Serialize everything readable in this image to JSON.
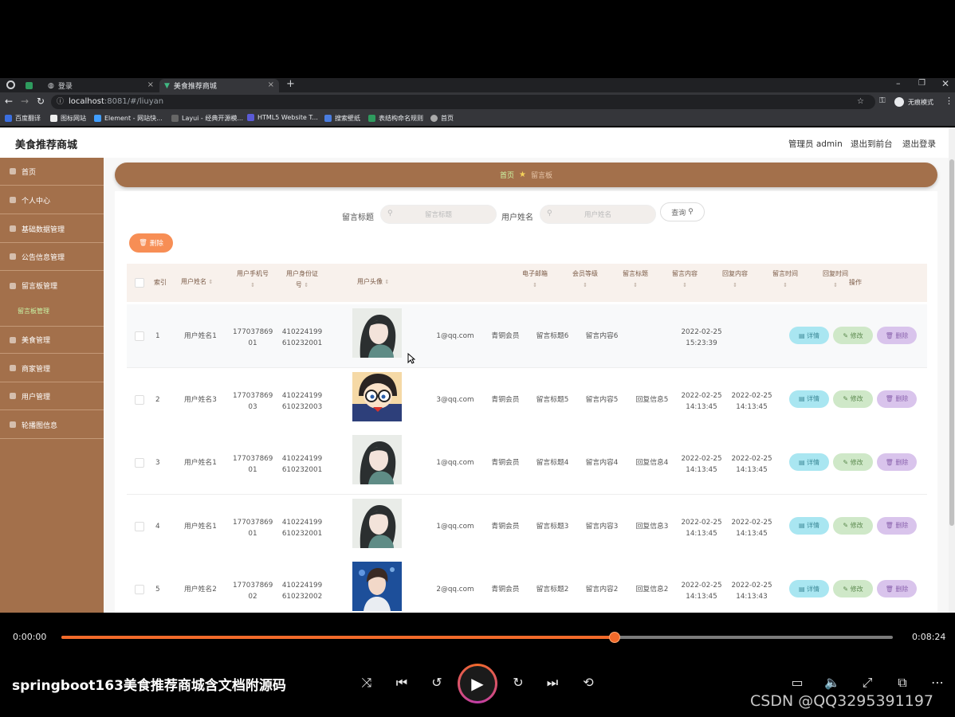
{
  "browser": {
    "tabs": [
      {
        "label": ""
      },
      {
        "label": "登录"
      },
      {
        "label": "美食推荐商城"
      }
    ],
    "url_host": "localhost",
    "url_rest": ":8081/#/liuyan",
    "profile_label": "无痕模式",
    "bookmarks": [
      "百度翻译",
      "图标网站",
      "Element - 网站快...",
      "Layui - 经典开源模...",
      "HTML5 Website T...",
      "搜索壁纸",
      "表结构命名规则",
      "首页"
    ]
  },
  "app": {
    "brand": "美食推荐商城",
    "header_links": {
      "admin": "管理员 admin",
      "front": "退出到前台",
      "logout": "退出登录"
    },
    "sidebar": {
      "items": [
        {
          "label": "首页"
        },
        {
          "label": "个人中心"
        },
        {
          "label": "基础数据管理"
        },
        {
          "label": "公告信息管理"
        },
        {
          "label": "留言板管理"
        },
        {
          "label": "美食管理"
        },
        {
          "label": "商家管理"
        },
        {
          "label": "用户管理"
        },
        {
          "label": "轮播图信息"
        }
      ],
      "active_sub": "留言板管理"
    },
    "breadcrumb": {
      "home": "首页",
      "current": "留言板"
    },
    "filters": {
      "title_label": "留言标题",
      "title_placeholder": "留言标题",
      "user_label": "用户姓名",
      "user_placeholder": "用户姓名",
      "search_button": "查询"
    },
    "delete_button": "删除",
    "table": {
      "headers": {
        "index": "索引",
        "user_name": "用户姓名",
        "phone": "用户手机号",
        "id_card_1": "用户身份证",
        "id_card_2": "号",
        "avatar": "用户头像",
        "email": "电子邮箱",
        "level": "会员等级",
        "msg_title": "留言标题",
        "msg_content": "留言内容",
        "reply_content": "回复内容",
        "msg_time": "留言时间",
        "reply_time": "回复时间",
        "actions": "操作"
      },
      "rows": [
        {
          "index": "1",
          "name": "用户姓名1",
          "phone_1": "177037869",
          "phone_2": "01",
          "id_1": "410224199",
          "id_2": "610232001",
          "email": "1@qq.com",
          "level": "青铜会员",
          "title": "留言标题6",
          "content": "留言内容6",
          "reply": "",
          "mtime_1": "2022-02-25",
          "mtime_2": "15:23:39",
          "rtime_1": "",
          "rtime_2": "",
          "avatar": "girl"
        },
        {
          "index": "2",
          "name": "用户姓名3",
          "phone_1": "177037869",
          "phone_2": "03",
          "id_1": "410224199",
          "id_2": "610232003",
          "email": "3@qq.com",
          "level": "青铜会员",
          "title": "留言标题5",
          "content": "留言内容5",
          "reply": "回复信息5",
          "mtime_1": "2022-02-25",
          "mtime_2": "14:13:45",
          "rtime_1": "2022-02-25",
          "rtime_2": "14:13:45",
          "avatar": "boy"
        },
        {
          "index": "3",
          "name": "用户姓名1",
          "phone_1": "177037869",
          "phone_2": "01",
          "id_1": "410224199",
          "id_2": "610232001",
          "email": "1@qq.com",
          "level": "青铜会员",
          "title": "留言标题4",
          "content": "留言内容4",
          "reply": "回复信息4",
          "mtime_1": "2022-02-25",
          "mtime_2": "14:13:45",
          "rtime_1": "2022-02-25",
          "rtime_2": "14:13:45",
          "avatar": "girl"
        },
        {
          "index": "4",
          "name": "用户姓名1",
          "phone_1": "177037869",
          "phone_2": "01",
          "id_1": "410224199",
          "id_2": "610232001",
          "email": "1@qq.com",
          "level": "青铜会员",
          "title": "留言标题3",
          "content": "留言内容3",
          "reply": "回复信息3",
          "mtime_1": "2022-02-25",
          "mtime_2": "14:13:45",
          "rtime_1": "2022-02-25",
          "rtime_2": "14:13:45",
          "avatar": "girl"
        },
        {
          "index": "5",
          "name": "用户姓名2",
          "phone_1": "177037869",
          "phone_2": "02",
          "id_1": "410224199",
          "id_2": "610232002",
          "email": "2@qq.com",
          "level": "青铜会员",
          "title": "留言标题2",
          "content": "留言内容2",
          "reply": "回复信息2",
          "mtime_1": "2022-02-25",
          "mtime_2": "14:13:45",
          "rtime_1": "2022-02-25",
          "rtime_2": "14:13:43",
          "avatar": "man"
        }
      ],
      "row_buttons": {
        "detail": "详情",
        "edit": "修改",
        "delete": "删除"
      }
    },
    "colors": {
      "accent": "#a3704b",
      "delete_button": "#f78e55"
    }
  },
  "player": {
    "current_time": "0:00:00",
    "total_time": "0:08:24",
    "progress_fraction": 0.665,
    "video_title": "springboot163美食推荐商城含文档附源码",
    "watermark": "CSDN @QQ3295391197",
    "controls": [
      "shuffle-icon",
      "previous-icon",
      "rewind-icon",
      "play-icon",
      "forward-30-icon",
      "next-icon",
      "loop-icon",
      "subtitles-icon",
      "volume-icon",
      "fullscreen-icon",
      "miniplayer-icon",
      "more-icon"
    ],
    "accent": "#f26a2a"
  }
}
